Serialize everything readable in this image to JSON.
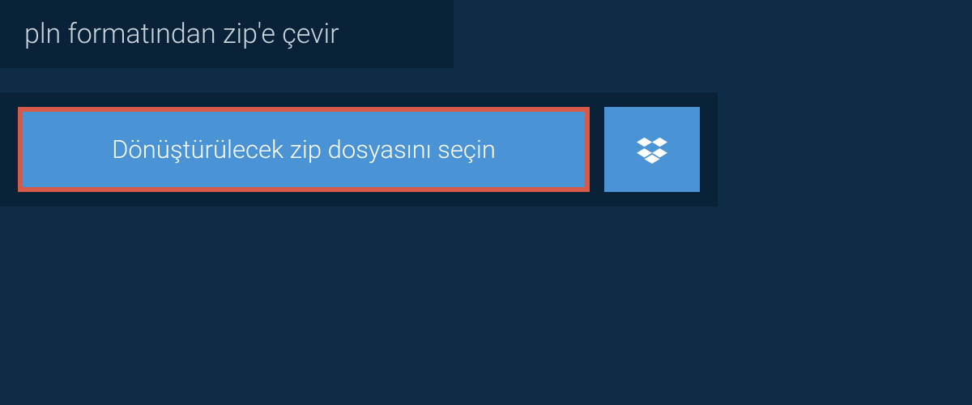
{
  "header": {
    "title": "pln formatından zip'e çevir"
  },
  "upload": {
    "select_file_label": "Dönüştürülecek zip dosyasını seçin"
  }
}
